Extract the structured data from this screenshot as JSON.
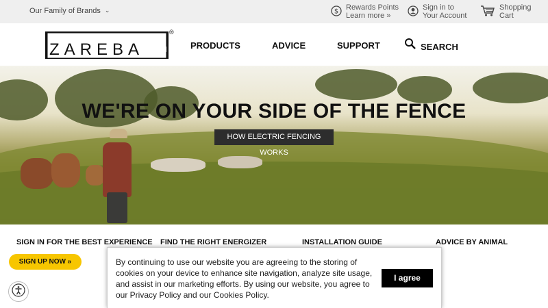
{
  "topbar": {
    "family_label": "Our Family of Brands",
    "rewards_line1": "Rewards Points",
    "rewards_line2": "Learn more »",
    "signin_line1": "Sign in to",
    "signin_line2": "Your Account",
    "cart_line1": "Shopping",
    "cart_line2": "Cart",
    "icons": {
      "family": "chevron-down-icon",
      "rewards": "dollar-coin-icon",
      "signin": "user-icon",
      "cart": "shopping-cart-icon"
    }
  },
  "header": {
    "logo_text": "ZAREBA",
    "logo_reg": "®",
    "nav": {
      "products": "PRODUCTS",
      "advice": "ADVICE",
      "support": "SUPPORT",
      "search": "SEARCH"
    }
  },
  "hero": {
    "title": "WE'RE ON YOUR SIDE OF THE FENCE",
    "button_label": "HOW ELECTRIC FENCING WORKS"
  },
  "quicklinks": {
    "signin_best": "SIGN IN FOR THE BEST EXPERIENCE",
    "find_energizer": "FIND THE RIGHT ENERGIZER",
    "installation": "INSTALLATION GUIDE",
    "advice_animal": "ADVICE BY ANIMAL"
  },
  "signup_label": "SIGN UP NOW »",
  "cookie": {
    "text": "By continuing to use our website you are agreeing to the storing of cookies on your device to enhance site navigation, analyze site usage, and assist in our marketing efforts. By using our website, you agree to our Privacy Policy and our Cookies Policy.",
    "button_label": "I agree"
  },
  "colors": {
    "signup_yellow": "#f7c600",
    "topbar_bg": "#efefef",
    "dark_button": "#2d2d2d"
  }
}
